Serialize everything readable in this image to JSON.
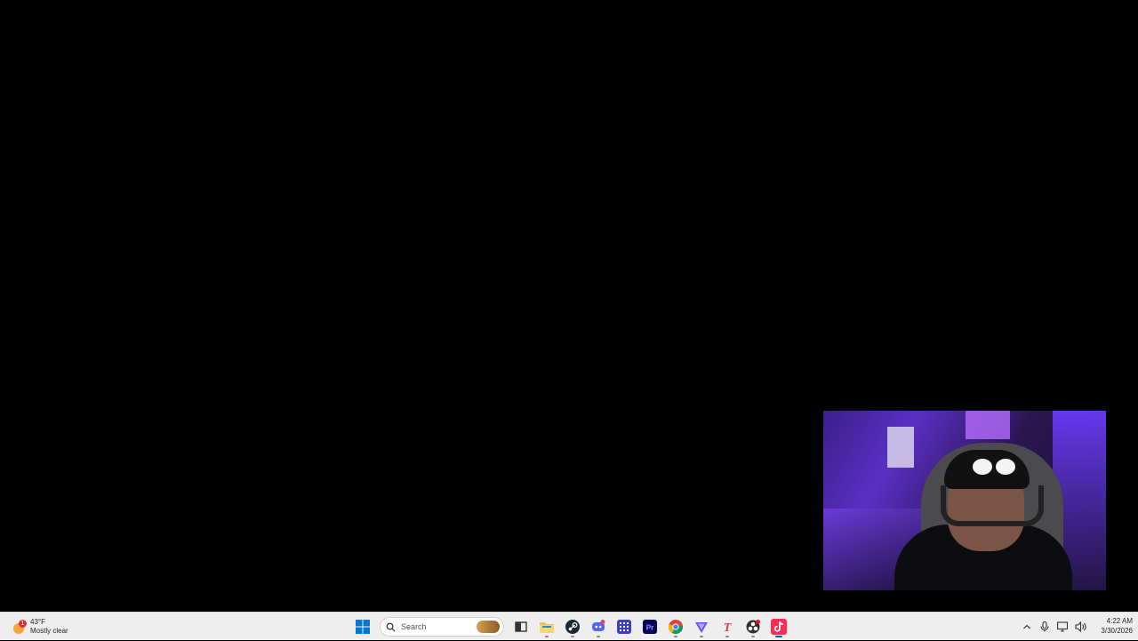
{
  "taskbar": {
    "weather": {
      "badge": "1",
      "temperature": "43°F",
      "condition": "Mostly clear"
    },
    "search": {
      "placeholder": "Search"
    },
    "apps": [
      {
        "name": "Start",
        "icon": "windows-start-icon"
      },
      {
        "name": "Task View",
        "icon": "task-view-icon"
      },
      {
        "name": "File Explorer",
        "icon": "folder-icon"
      },
      {
        "name": "Steam",
        "icon": "steam-icon"
      },
      {
        "name": "Discord",
        "icon": "discord-icon"
      },
      {
        "name": "App Grid",
        "icon": "grid-app-icon"
      },
      {
        "name": "Premiere Pro",
        "icon": "premiere-pro-icon",
        "label": "Pr"
      },
      {
        "name": "Chrome",
        "icon": "chrome-icon"
      },
      {
        "name": "Proton VPN",
        "icon": "triangle-app-icon"
      },
      {
        "name": "Text App",
        "icon": "t-letter-icon",
        "label": "T"
      },
      {
        "name": "OBS",
        "icon": "obs-icon"
      },
      {
        "name": "TikTok",
        "icon": "tiktok-icon"
      }
    ],
    "tray": {
      "chevron": "show-hidden-icons",
      "time": "4:22 AM",
      "date": "3/30/2026"
    }
  },
  "colors": {
    "desktop": "#000000",
    "taskbar": "#eeeeee",
    "accent": "#005fb8"
  }
}
